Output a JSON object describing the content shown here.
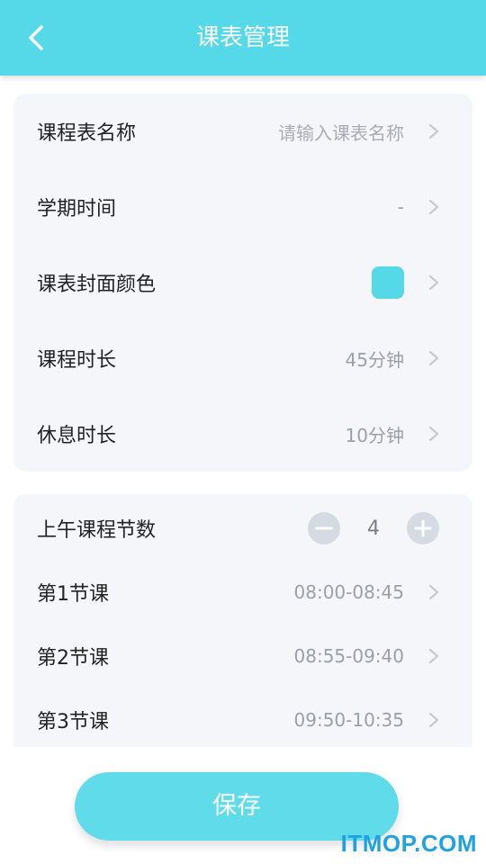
{
  "header": {
    "title": "课表管理",
    "back_icon": "chevron-left-icon"
  },
  "basic_settings": {
    "name": {
      "label": "课程表名称",
      "placeholder": "请输入课表名称"
    },
    "term": {
      "label": "学期时间",
      "value": "-"
    },
    "cover_color": {
      "label": "课表封面颜色",
      "color": "#55d8e8"
    },
    "lesson_duration": {
      "label": "课程时长",
      "value": "45分钟"
    },
    "break_duration": {
      "label": "休息时长",
      "value": "10分钟"
    }
  },
  "morning": {
    "label": "上午课程节数",
    "count": "4",
    "decrement_icon": "minus-icon",
    "increment_icon": "plus-icon",
    "lessons": [
      {
        "label": "第1节课",
        "time": "08:00-08:45"
      },
      {
        "label": "第2节课",
        "time": "08:55-09:40"
      },
      {
        "label": "第3节课",
        "time": "09:50-10:35"
      }
    ]
  },
  "save_label": "保存",
  "watermark": "ITMOP.COM",
  "colors": {
    "accent": "#55d8e8",
    "card_bg": "#f4f6fa"
  }
}
